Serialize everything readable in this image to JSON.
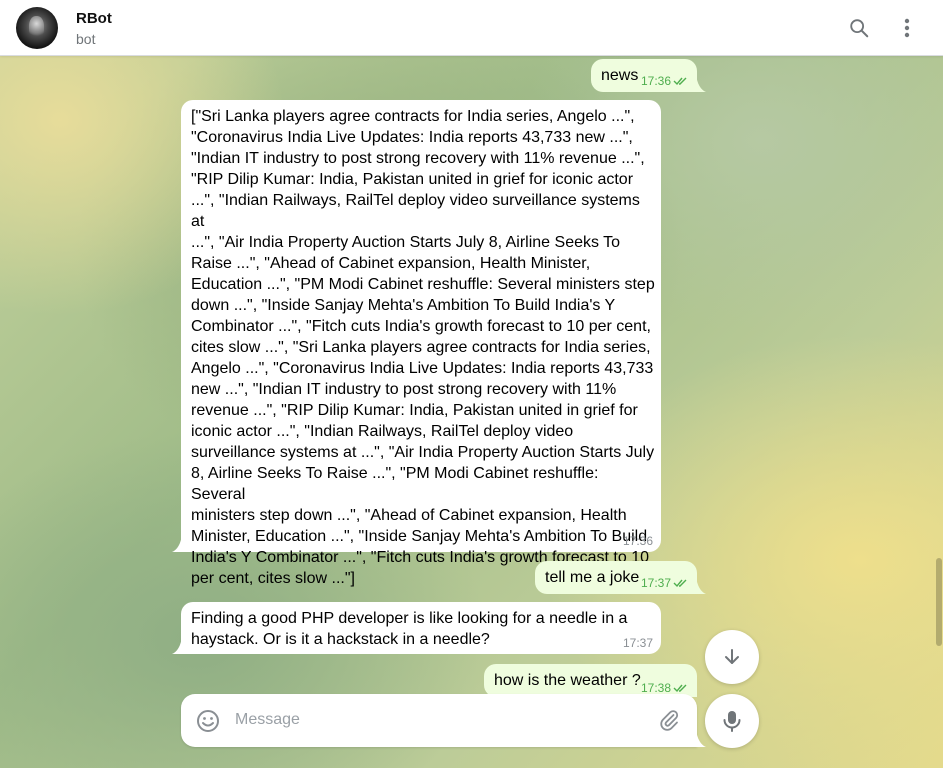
{
  "header": {
    "title": "RBot",
    "subtitle": "bot",
    "icons": {
      "search": "search-icon",
      "more": "more-vertical-icon"
    }
  },
  "messages": [
    {
      "id": "m1",
      "direction": "out",
      "text": "news",
      "time": "17:36",
      "status": "read"
    },
    {
      "id": "m2",
      "direction": "in",
      "text": "[\"Sri Lanka players agree contracts for India series, Angelo ...\",\n\"Coronavirus India Live Updates: India reports 43,733 new ...\",\n\"Indian IT industry to post strong recovery with 11% revenue ...\",\n\"RIP Dilip Kumar: India, Pakistan united in grief for iconic actor\n...\", \"Indian Railways, RailTel deploy video surveillance systems at\n...\", \"Air India Property Auction Starts July 8, Airline Seeks To\nRaise ...\", \"Ahead of Cabinet expansion, Health Minister,\nEducation ...\", \"PM Modi Cabinet reshuffle: Several ministers step\ndown ...\", \"Inside Sanjay Mehta's Ambition To Build India's Y\nCombinator ...\", \"Fitch cuts India's growth forecast to 10 per cent,\ncites slow ...\", \"Sri Lanka players agree contracts for India series,\nAngelo ...\", \"Coronavirus India Live Updates: India reports 43,733\nnew ...\", \"Indian IT industry to post strong recovery with 11%\nrevenue ...\", \"RIP Dilip Kumar: India, Pakistan united in grief for\niconic actor ...\", \"Indian Railways, RailTel deploy video\nsurveillance systems at ...\", \"Air India Property Auction Starts July\n8, Airline Seeks To Raise ...\", \"PM Modi Cabinet reshuffle: Several\nministers step down ...\", \"Ahead of Cabinet expansion, Health\nMinister, Education ...\", \"Inside Sanjay Mehta's Ambition To Build\nIndia's Y Combinator ...\", \"Fitch cuts India's growth forecast to 10\nper cent, cites slow ...\"]",
      "time": "17:36"
    },
    {
      "id": "m3",
      "direction": "out",
      "text": "tell me a joke",
      "time": "17:37",
      "status": "read"
    },
    {
      "id": "m4",
      "direction": "in",
      "text": "Finding a good PHP developer is like looking for a needle in a\nhaystack. Or is it a hackstack in a needle?",
      "time": "17:37"
    },
    {
      "id": "m5",
      "direction": "out",
      "text": "how is the weather ?",
      "time": "17:38",
      "status": "read"
    }
  ],
  "composer": {
    "placeholder": "Message",
    "value": "",
    "icons": {
      "emoji": "emoji-icon",
      "attach": "paperclip-icon",
      "voice": "microphone-icon"
    }
  },
  "scroll_down": {
    "icon": "arrow-down-icon"
  },
  "colors": {
    "outgoing_bubble": "#effdde",
    "incoming_bubble": "#ffffff",
    "read_check": "#4fae4e",
    "header_bg": "#ffffff"
  }
}
